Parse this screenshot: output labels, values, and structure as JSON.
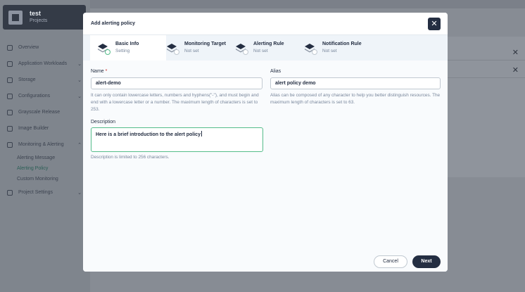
{
  "project": {
    "name": "test",
    "subtitle": "Projects"
  },
  "sidebar": {
    "items": [
      {
        "label": "Overview"
      },
      {
        "label": "Application Workloads"
      },
      {
        "label": "Storage"
      },
      {
        "label": "Configurations"
      },
      {
        "label": "Grayscale Release"
      },
      {
        "label": "Image Builder"
      },
      {
        "label": "Monitoring & Alerting"
      }
    ],
    "subitems": [
      {
        "label": "Alerting Message"
      },
      {
        "label": "Alerting Policy"
      },
      {
        "label": "Custom Monitoring"
      }
    ],
    "settings": {
      "label": "Project Settings"
    }
  },
  "modal": {
    "title": "Add alerting policy",
    "close_label": "✕",
    "steps": [
      {
        "title": "Basic Info",
        "status": "Setting"
      },
      {
        "title": "Monitoring Target",
        "status": "Not set"
      },
      {
        "title": "Alerting Rule",
        "status": "Not set"
      },
      {
        "title": "Notification Rule",
        "status": "Not set"
      }
    ],
    "form": {
      "name": {
        "label": "Name",
        "required_mark": "*",
        "value": "alert-demo",
        "hint": "It can only contain lowercase letters, numbers and hyphens(\"-\"), and must begin and end with a lowercase letter or a number. The maximum length of characters is set to 253."
      },
      "alias": {
        "label": "Alias",
        "value": "alert policy demo",
        "hint": "Alias can be composed of any character to help you better distinguish resources. The maximum length of characters is set to 63."
      },
      "description": {
        "label": "Description",
        "value": "Here is a brief introduction to the alert policy",
        "hint": "Description is limited to 256 characters."
      }
    },
    "buttons": {
      "cancel": "Cancel",
      "next": "Next"
    }
  },
  "background": {
    "close_icon": "✕"
  },
  "colors": {
    "primary": "#242e42",
    "accent_green": "#55bc8a",
    "required_red": "#ca2621",
    "overlay": "#878c94"
  }
}
